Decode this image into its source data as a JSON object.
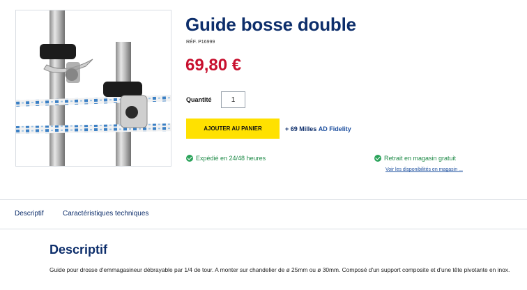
{
  "product": {
    "title": "Guide bosse double",
    "ref": "RÉF. P16999",
    "price": "69,80 €",
    "image_icon": "product-photo"
  },
  "purchase": {
    "quantity_label": "Quantité",
    "quantity_value": "1",
    "add_to_cart_label": "AJOUTER AU PANIER",
    "fidelity_miles": "+ 69 Milles",
    "fidelity_program": "AD Fidelity"
  },
  "delivery": {
    "shipping_text": "Expédié en 24/48 heures",
    "pickup_text": "Retrait en magasin gratuit",
    "availability_link": "Voir les disponibilités en magasin ..."
  },
  "tabs": [
    {
      "label": "Descriptif"
    },
    {
      "label": "Caractéristiques techniques"
    }
  ],
  "description": {
    "title": "Descriptif",
    "text": "Guide pour drosse d'emmagasineur débrayable par 1/4 de tour. A monter sur chandelier de ø 25mm ou ø 30mm. Composé d'un support composite et d'une tête pivotante en inox."
  },
  "colors": {
    "brand_navy": "#0d2e6b",
    "price_red": "#c8102e",
    "cta_yellow": "#ffe100",
    "success_green": "#2aa35a"
  }
}
